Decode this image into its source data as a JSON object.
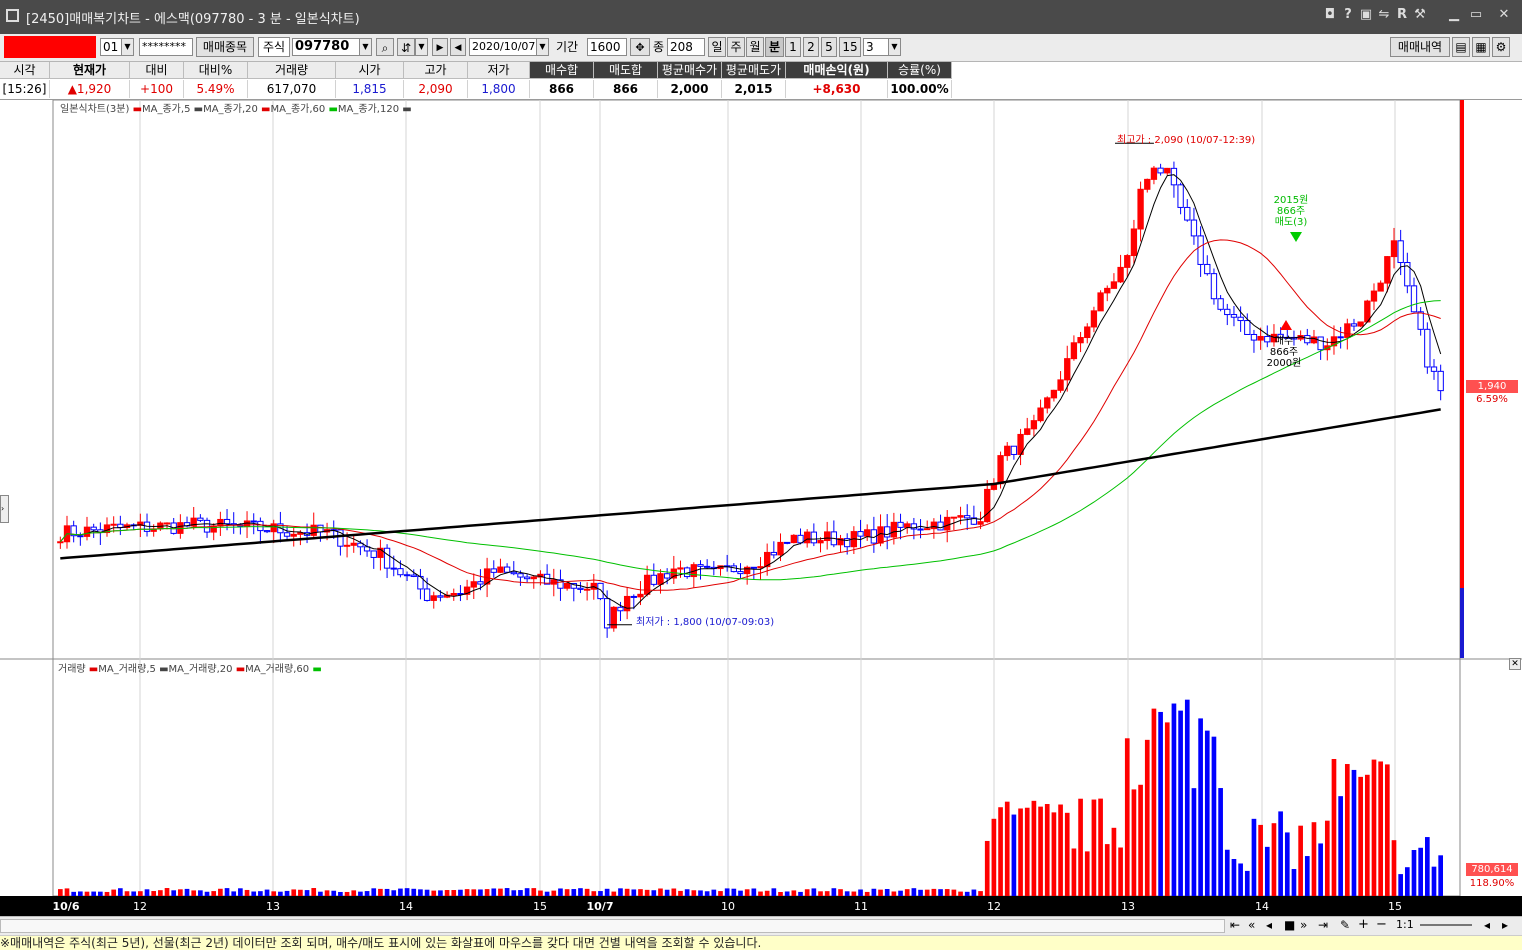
{
  "window": {
    "title": "[2450]매매복기차트 - 에스맥(097780 - 3 분 - 일본식차트)"
  },
  "toolbar": {
    "account_no": "01",
    "password": "********",
    "trade_item_button": "매매종목",
    "market_label": "주식",
    "stock_code": "097780",
    "date": "2020/10/07",
    "period_label": "기간",
    "period_value": "1600",
    "count_label": "종",
    "count_value": "208",
    "tf_day": "일",
    "tf_week": "주",
    "tf_month": "월",
    "tf_minute": "분",
    "tf_1": "1",
    "tf_2": "2",
    "tf_5": "5",
    "tf_15": "15",
    "tf_selected": "3",
    "trade_history_button": "매매내역"
  },
  "quote": {
    "headers": [
      "시각",
      "현재가",
      "대비",
      "대비%",
      "거래량",
      "시가",
      "고가",
      "저가",
      "매수합",
      "매도합",
      "평균매수가",
      "평균매도가",
      "매매손익(원)",
      "승률(%)"
    ],
    "values": [
      "[15:26]",
      "▲1,920",
      "+100",
      "5.49%",
      "617,070",
      "1,815",
      "2,090",
      "1,800",
      "866",
      "866",
      "2,000",
      "2,015",
      "+8,630",
      "100.00%"
    ]
  },
  "price_legend": {
    "title": "일본식차트(3분)",
    "ma5": "MA_종가,5",
    "ma20": "MA_종가,20",
    "ma60": "MA_종가,60",
    "ma120": "MA_종가,120"
  },
  "volume_legend": {
    "title": "거래량",
    "ma5": "MA_거래량,5",
    "ma20": "MA_거래량,20",
    "ma60": "MA_거래량,60"
  },
  "annotations": {
    "high": "최고가 : 2,090 (10/07-12:39)",
    "low": "최저가 : 1,800 (10/07-09:03)",
    "sell_line1": "2015원",
    "sell_line2": "866주",
    "sell_line3": "매도(3)",
    "buy_line1": "매수",
    "buy_line2": "866주",
    "buy_line3": "2000원"
  },
  "price_badge": {
    "value": "1,940",
    "pct": "6.59%"
  },
  "volume_badge": {
    "value": "780,614",
    "pct": "118.90%"
  },
  "x_axis": {
    "labels": [
      "10/6",
      "12",
      "13",
      "14",
      "15",
      "10/7",
      "10",
      "11",
      "12",
      "13",
      "14",
      "15"
    ]
  },
  "nav": {
    "zoom": "1:1"
  },
  "status_text": "※매매내역은 주식(최근 5년), 선물(최근 2년) 데이터만 조회 되며, 매수/매도 표시에 있는 화살표에 마우스를 갖다 대면 건별 내역을 조회할 수 있습니다.",
  "colors": {
    "up": "#ff0000",
    "down": "#0000ff",
    "ma5": "#000000",
    "ma20": "#e00000",
    "ma60": "#00c000",
    "ma120": "#000000",
    "sell_marker": "#00cc00"
  },
  "chart_data": {
    "type": "candlestick",
    "timeframe": "3분",
    "y_range_price": [
      1780,
      2110
    ],
    "price_high": 2090,
    "price_low": 1800,
    "last_price": 1920,
    "series": [
      {
        "name": "MA_종가,5"
      },
      {
        "name": "MA_종가,20"
      },
      {
        "name": "MA_종가,60"
      },
      {
        "name": "MA_종가,120"
      },
      {
        "name": "거래량"
      },
      {
        "name": "MA_거래량,5"
      },
      {
        "name": "MA_거래량,20"
      },
      {
        "name": "MA_거래량,60"
      }
    ],
    "trades": [
      {
        "side": "매수",
        "qty": 866,
        "price": 2000
      },
      {
        "side": "매도",
        "qty": 866,
        "price": 2015
      }
    ]
  }
}
